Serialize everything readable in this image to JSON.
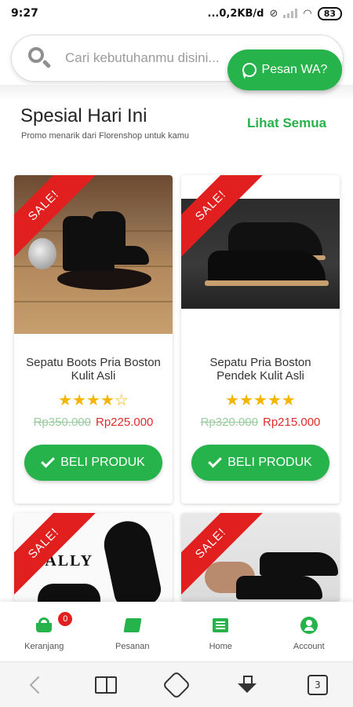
{
  "status_bar": {
    "time": "9:27",
    "network": "...0,2KB/d",
    "battery": "83"
  },
  "search": {
    "placeholder": "Cari kebutuhanmu disini..."
  },
  "wa_button": {
    "label": "Pesan WA?"
  },
  "section": {
    "title": "Spesial Hari Ini",
    "subtitle": "Promo menarik dari Florenshop untuk kamu",
    "see_all": "Lihat Semua"
  },
  "colors": {
    "brand_green": "#27b34b",
    "sale_red": "#e11f1f",
    "price_red": "#e02b2b",
    "star_gold": "#f4b400"
  },
  "products": [
    {
      "sale_label": "SALE!",
      "name": "Sepatu Boots Pria Boston Kulit Asli",
      "rating": 4.5,
      "stars": "★★★★☆",
      "price_old": "Rp350.000",
      "price_new": "Rp225.000",
      "button": "BELI PRODUK"
    },
    {
      "sale_label": "SALE!",
      "name": "Sepatu Pria Boston Pendek Kulit Asli",
      "rating": 5,
      "stars": "★★★★★",
      "price_old": "Rp320.000",
      "price_new": "Rp215.000",
      "button": "BELI PRODUK"
    },
    {
      "sale_label": "SALE!",
      "image_brand": "BALLY"
    },
    {
      "sale_label": "SALE!"
    }
  ],
  "tabbar": {
    "cart_badge": "0",
    "items": [
      {
        "label": "Keranjang",
        "icon": "cart-icon"
      },
      {
        "label": "Pesanan",
        "icon": "orders-icon"
      },
      {
        "label": "Home",
        "icon": "list-icon"
      },
      {
        "label": "Account",
        "icon": "account-icon"
      }
    ]
  },
  "system_nav": {
    "tabs_count": "3"
  }
}
